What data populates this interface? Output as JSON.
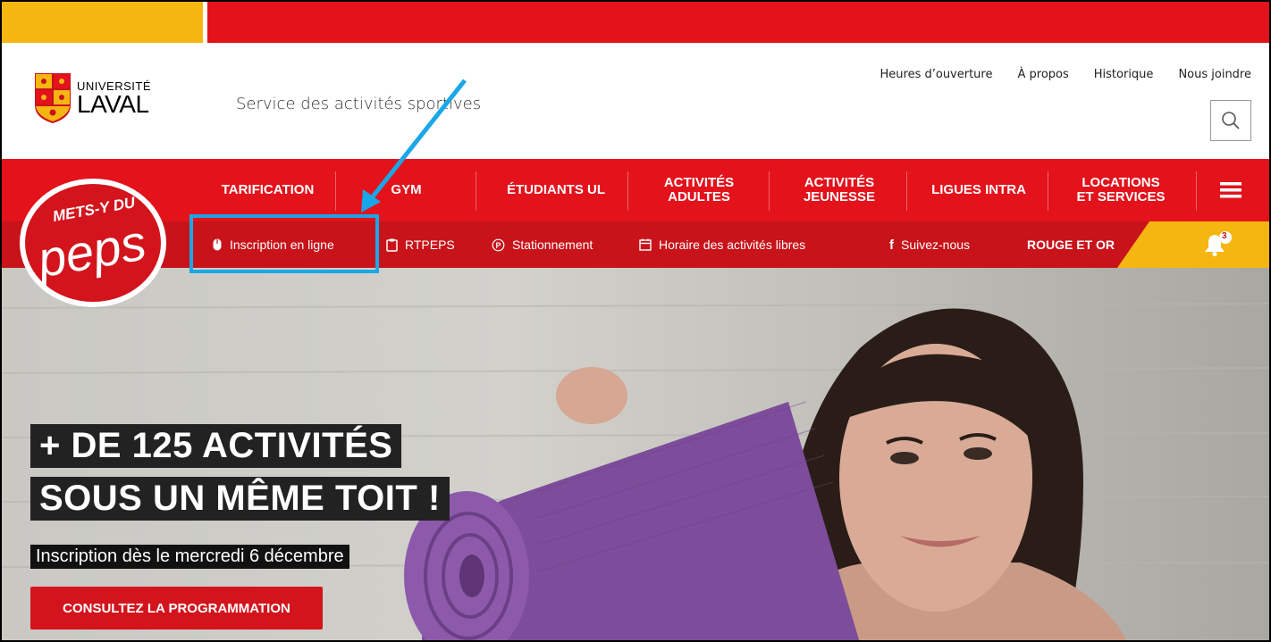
{
  "colors": {
    "brand_red": "#e3121b",
    "dark_red": "#c8131a",
    "gold": "#f6b612",
    "annotation_blue": "#1aa7e8"
  },
  "logo": {
    "line1": "UNIVERSITÉ",
    "line2": "LAVAL"
  },
  "header": {
    "service": "Service des activités sportives",
    "links": [
      "Heures d’ouverture",
      "À propos",
      "Historique",
      "Nous joindre"
    ],
    "search_icon": "search-icon"
  },
  "badge": {
    "line1": "METS-Y DU",
    "line2": "peps"
  },
  "nav": {
    "items": [
      "TARIFICATION",
      "GYM",
      "ÉTUDIANTS UL",
      "ACTIVITÉS\nADULTES",
      "ACTIVITÉS\nJEUNESSE",
      "LIGUES INTRA",
      "LOCATIONS\nET SERVICES"
    ],
    "menu_icon": "hamburger-icon"
  },
  "subnav": {
    "items": [
      {
        "label": "Inscription en ligne",
        "icon": "mouse-icon"
      },
      {
        "label": "RTPEPS",
        "icon": "clipboard-icon"
      },
      {
        "label": "Stationnement",
        "icon": "parking-icon"
      },
      {
        "label": "Horaire des activités libres",
        "icon": "calendar-icon"
      },
      {
        "label": "Suivez-nous",
        "icon": "facebook-icon"
      },
      {
        "label": "ROUGE ET OR",
        "icon": ""
      }
    ],
    "notification_count": "3"
  },
  "hero": {
    "headline_line1": "+ DE 125 ACTIVITÉS",
    "headline_line2": "SOUS UN MÊME TOIT !",
    "subheadline": "Inscription dès le mercredi 6 décembre",
    "cta": "CONSULTEZ LA PROGRAMMATION"
  }
}
